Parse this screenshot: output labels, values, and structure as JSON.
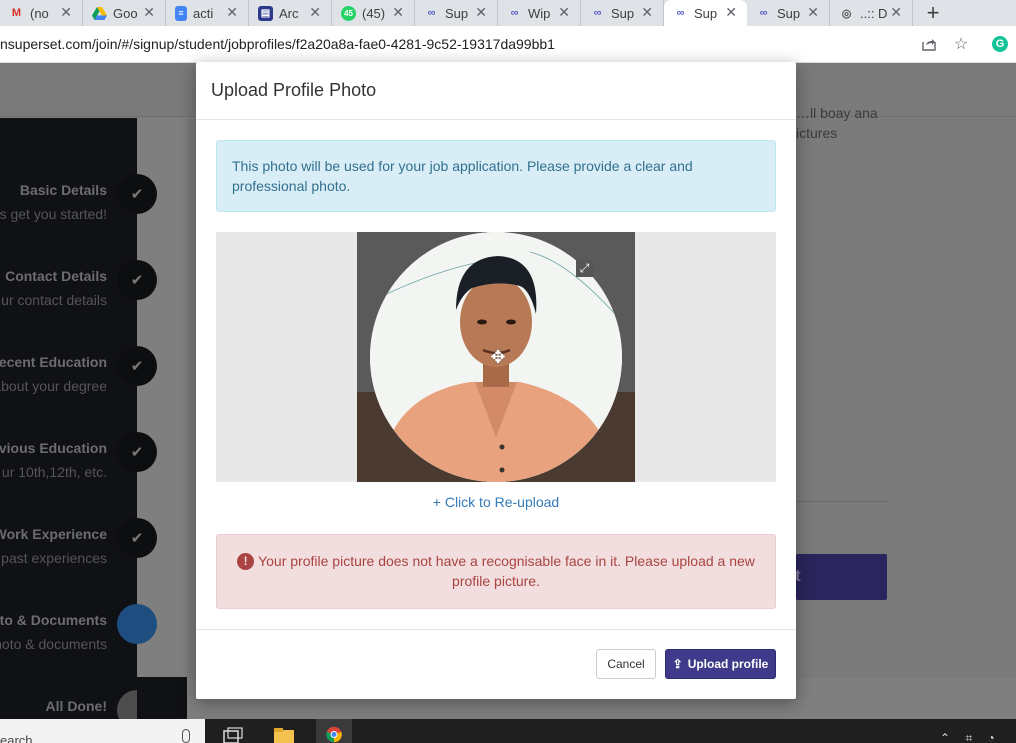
{
  "browser": {
    "tabs": [
      {
        "icon": "gmail-icon",
        "title": "(no",
        "active": false
      },
      {
        "icon": "drive-icon",
        "title": "Goo",
        "active": false
      },
      {
        "icon": "docs-icon",
        "title": "acti",
        "active": false
      },
      {
        "icon": "forms-icon",
        "title": "Arc",
        "active": false
      },
      {
        "icon": "whatsapp-icon",
        "title": "(45)",
        "badge": "45",
        "active": false
      },
      {
        "icon": "superset-icon",
        "title": "Sup",
        "active": false
      },
      {
        "icon": "superset-icon",
        "title": "Wip",
        "active": false
      },
      {
        "icon": "superset-icon",
        "title": "Sup",
        "active": false
      },
      {
        "icon": "superset-icon",
        "title": "Sup",
        "active": true
      },
      {
        "icon": "superset-icon",
        "title": "Sup",
        "active": false
      },
      {
        "icon": "camera-icon",
        "title": "..:: D",
        "active": false
      }
    ],
    "new_tab_label": "+",
    "url": "nsuperset.com/join/#/signup/student/jobprofiles/f2a20a8a-fae0-4281-9c52-19317da99bb1"
  },
  "sidebar": {
    "steps": [
      {
        "title": "Basic Details",
        "subtitle": "s get you started!",
        "state": "done"
      },
      {
        "title": "Contact Details",
        "subtitle": "ur contact details",
        "state": "done"
      },
      {
        "title": "ecent Education",
        "subtitle": "about your degree",
        "state": "done"
      },
      {
        "title": "vious Education",
        "subtitle": "ur 10th,12th, etc.",
        "state": "done"
      },
      {
        "title": "Work Experience",
        "subtitle": "past experiences",
        "state": "done"
      },
      {
        "title": "to & Documents",
        "subtitle": "hoto & documents",
        "state": "current"
      },
      {
        "title": "All Done!",
        "subtitle": "",
        "state": "pending"
      }
    ]
  },
  "background": {
    "text_line1": "…ll boay ana",
    "text_line2": "ictures",
    "button_fragment": "t"
  },
  "modal": {
    "title": "Upload Profile Photo",
    "info_text": "This photo will be used for your job application. Please provide a clear and professional photo.",
    "reupload_label": "+ Click to Re-upload",
    "error_icon": "!",
    "error_text": "Your profile picture does not have a recognisable face in it. Please upload a new profile picture.",
    "cancel_label": "Cancel",
    "upload_label": "Upload profile",
    "upload_icon": "⇪"
  },
  "taskbar": {
    "search_placeholder": "earch"
  },
  "colors": {
    "brand_primary": "#3f3a8a",
    "info_bg": "#d9edf7",
    "info_text": "#31708f",
    "error_bg": "#f2dede",
    "error_text": "#a94442",
    "link": "#337ab7"
  }
}
